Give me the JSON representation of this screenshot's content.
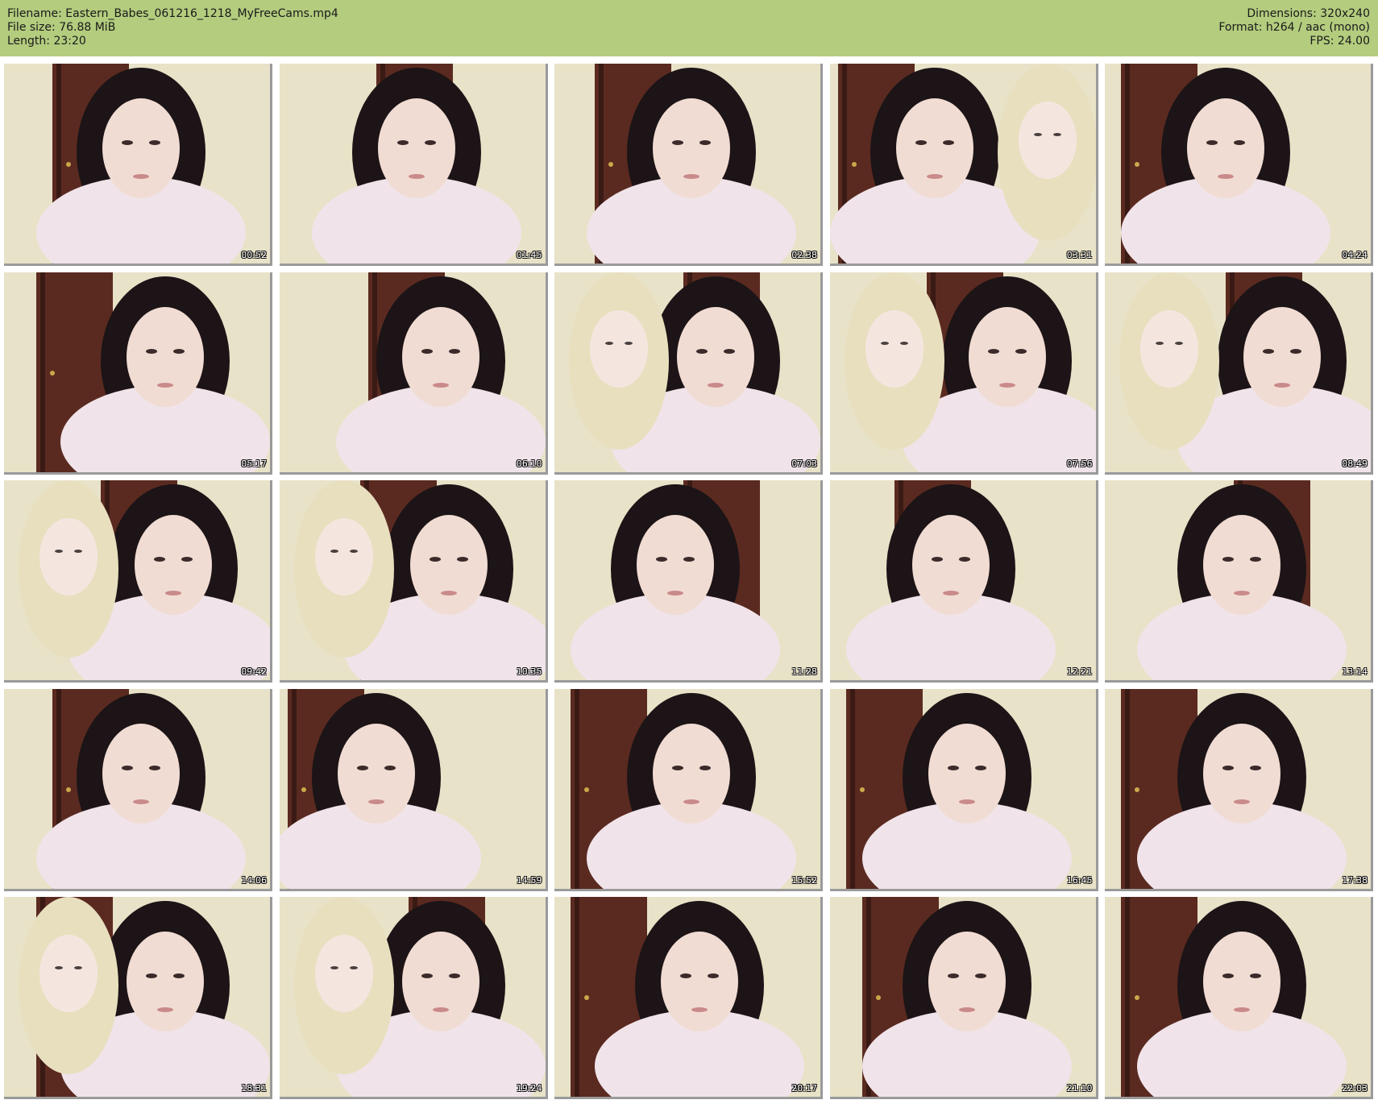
{
  "header": {
    "filename": "Filename: Eastern_Babes_061216_1218_MyFreeCams.mp4",
    "filesize": "File size: 76.88 MiB",
    "length": "Length: 23:20",
    "dimensions": "Dimensions: 320x240",
    "format": "Format: h264 / aac (mono)",
    "fps": "FPS: 24.00"
  },
  "colors": {
    "header_bg": "#b3cc7e",
    "door": "#5a2a20",
    "wall": "#e8e2c8",
    "hair_dark": "#1c1416",
    "hair_blonde": "#e8dfbf",
    "skin": "#f1dcd3",
    "sweater": "#f0e4ea"
  },
  "thumbnails": [
    {
      "time": "00:52",
      "scene": "dark"
    },
    {
      "time": "01:45",
      "scene": "dark"
    },
    {
      "time": "02:38",
      "scene": "dark"
    },
    {
      "time": "03:31",
      "scene": "duo"
    },
    {
      "time": "04:24",
      "scene": "dark"
    },
    {
      "time": "05:17",
      "scene": "dark"
    },
    {
      "time": "06:10",
      "scene": "dark"
    },
    {
      "time": "07:03",
      "scene": "duo"
    },
    {
      "time": "07:56",
      "scene": "duo"
    },
    {
      "time": "08:49",
      "scene": "duo"
    },
    {
      "time": "09:42",
      "scene": "duo"
    },
    {
      "time": "10:35",
      "scene": "duo"
    },
    {
      "time": "11:28",
      "scene": "dark"
    },
    {
      "time": "12:21",
      "scene": "dark"
    },
    {
      "time": "13:14",
      "scene": "dark"
    },
    {
      "time": "14:06",
      "scene": "dark"
    },
    {
      "time": "14:59",
      "scene": "dark"
    },
    {
      "time": "15:52",
      "scene": "dark"
    },
    {
      "time": "16:45",
      "scene": "dark"
    },
    {
      "time": "17:38",
      "scene": "dark"
    },
    {
      "time": "18:31",
      "scene": "duo"
    },
    {
      "time": "19:24",
      "scene": "duo"
    },
    {
      "time": "20:17",
      "scene": "dark"
    },
    {
      "time": "21:10",
      "scene": "dark"
    },
    {
      "time": "22:03",
      "scene": "dark"
    }
  ]
}
